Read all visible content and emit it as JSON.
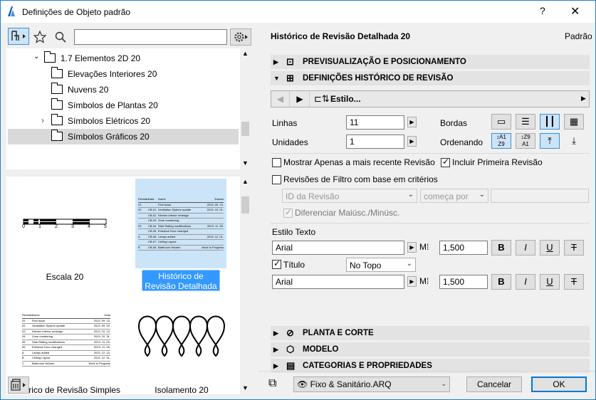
{
  "window": {
    "title": "Definições de Objeto padrão",
    "help_label": "?",
    "close_label": "✕"
  },
  "toolbar": {
    "search_value": ""
  },
  "tree": {
    "items": [
      {
        "label": "1.7 Elementos 2D 20",
        "expanded": true
      },
      {
        "label": "Elevações Interiores 20"
      },
      {
        "label": "Nuvens 20"
      },
      {
        "label": "Símbolos de Plantas 20"
      },
      {
        "label": "Símbolos Elétricos 20",
        "collapsed": true
      },
      {
        "label": "Símbolos Gráficos 20",
        "selected": true
      }
    ]
  },
  "gallery": {
    "items": [
      {
        "label": "Escala 20"
      },
      {
        "label": "Histórico de Revisão Detalhada 20",
        "selected": true
      },
      {
        "label": "Histórico de Revisão Simples"
      },
      {
        "label": "Isolamento 20"
      }
    ],
    "scale_ticks": [
      "0",
      "1",
      "2",
      "3",
      "4",
      "5"
    ],
    "detailed_table": {
      "headers": [
        "Revisão",
        "Data",
        "Nome",
        "Estado"
      ],
      "rows": [
        [
          "01",
          "",
          "First issue",
          "2013. 09. 13."
        ],
        [
          "02",
          "CB-01",
          "Ventilation System update",
          "2013. 10. 01."
        ],
        [
          "",
          "CB-02",
          "Kitchen interior redesign",
          ""
        ],
        [
          "",
          "CB-03",
          "Zone numbering",
          ""
        ],
        [
          "03",
          "CB-04",
          "Stair Railing modifications",
          "2013. 11. 30."
        ],
        [
          "",
          "CB-05",
          "Entrance Door changed",
          ""
        ],
        [
          "A",
          "CB-06",
          "Lamps added",
          "2013. 12. 01."
        ],
        [
          "",
          "CB-07",
          "Ceiling Layout",
          ""
        ],
        [
          "B",
          "CB-08",
          "Bathroom fixtures",
          "Work in Progress"
        ]
      ]
    },
    "simple_table": {
      "headers": [
        "Revisão",
        "Nome",
        "Data"
      ],
      "rows": [
        [
          "01",
          "First issue",
          "2013. 09. 13."
        ],
        [
          "02",
          "Ventilation System update",
          "2013. 09. 20."
        ],
        [
          "03",
          "Kitchen interior redesign",
          "2013. 10. 13."
        ],
        [
          "04",
          "Zone numbering",
          "2013. 10. 31."
        ],
        [
          "05",
          "Stair Railing modifications",
          "2013. 11. 03."
        ],
        [
          "06",
          "Entrance Door changed",
          "2013. 11. 05."
        ],
        [
          "A",
          "Lamps added",
          "2013. 12. 13."
        ],
        [
          "B",
          "Ceiling Layout",
          "2013. 12. 31."
        ],
        [
          "C",
          "Bathroom fixtures",
          "Work in Progress"
        ]
      ]
    }
  },
  "panel": {
    "object_name": "Histórico de Revisão Detalhada 20",
    "default_label": "Padrão",
    "sections": {
      "preview": "PREVISUALIZAÇÃO E POSICIONAMENTO",
      "settings": "DEFINIÇÕES HISTÓRICO DE REVISÃO",
      "plan": "PLANTA E CORTE",
      "model": "MODELO",
      "categories": "CATEGORIAS E PROPRIEDADES"
    },
    "style_button": "Estilo...",
    "rows_label": "Linhas",
    "rows_value": "11",
    "units_label": "Unidades",
    "units_value": "1",
    "borders_label": "Bordas",
    "ordering_label": "Ordenando",
    "show_recent_label": "Mostrar Apenas a mais recente Revisão",
    "show_recent_checked": false,
    "include_first_label": "Incluir Primeira Revisão",
    "include_first_checked": true,
    "filter_label": "Revisões de Filtro com base em critérios",
    "filter_checked": false,
    "filter_field": "ID da Revisão",
    "filter_op": "começa por",
    "filter_value": "",
    "case_label": "Diferenciar Maiúsc./Minúsc.",
    "case_checked": true,
    "text_style_label": "Estilo Texto",
    "font1": "Arial",
    "size1": "1,500",
    "title_label": "Título",
    "title_checked": true,
    "title_position": "No Topo",
    "font2": "Arial",
    "size2": "1,500",
    "bold": "B",
    "italic": "I",
    "underline": "U",
    "strike": "T"
  },
  "footer": {
    "layer": "Fixo & Sanitário.ARQ",
    "cancel": "Cancelar",
    "ok": "OK"
  },
  "colors": {
    "accent": "#1883d7",
    "selection": "#cce4f7",
    "selected_label_bg": "#3399ff"
  }
}
